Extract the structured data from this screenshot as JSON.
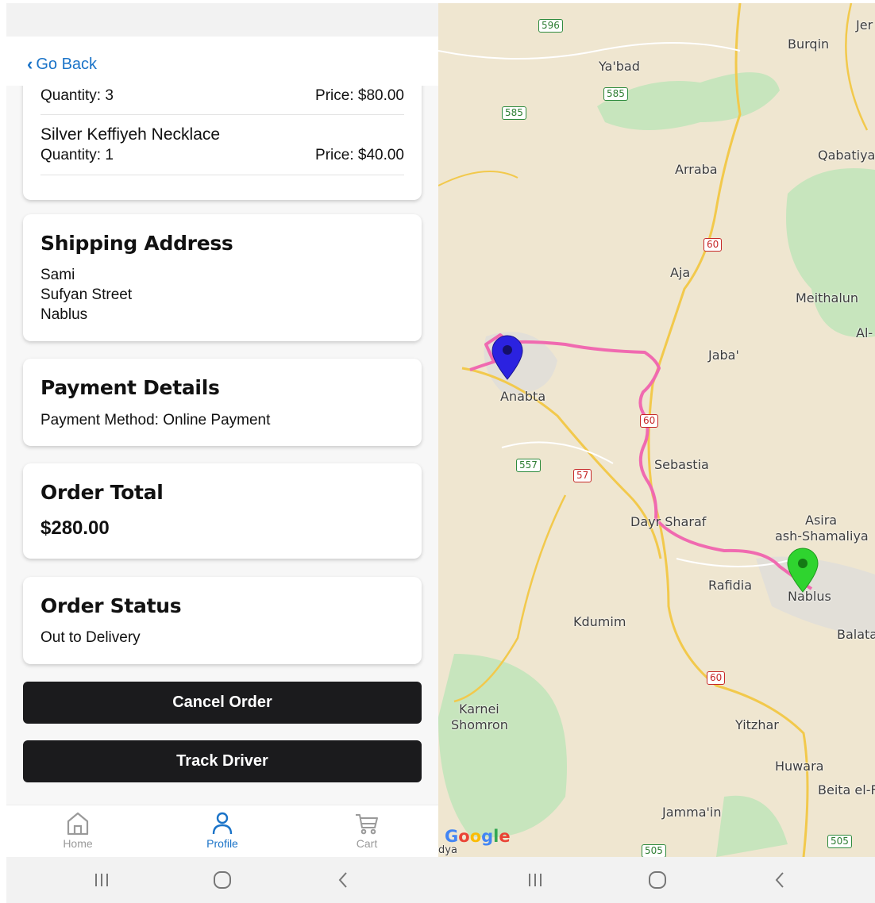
{
  "nav": {
    "back_label": "Go Back"
  },
  "order_items": [
    {
      "name": "",
      "quantity": "Quantity: 3",
      "price": "Price: $80.00"
    },
    {
      "name": "Silver Keffiyeh Necklace",
      "quantity": "Quantity: 1",
      "price": "Price: $40.00"
    }
  ],
  "shipping": {
    "title": "Shipping Address",
    "name": "Sami",
    "street": "Sufyan Street",
    "city": "Nablus"
  },
  "payment": {
    "title": "Payment Details",
    "method": "Payment Method: Online Payment"
  },
  "total": {
    "title": "Order Total",
    "amount": "$280.00"
  },
  "status": {
    "title": "Order Status",
    "value": "Out to Delivery"
  },
  "buttons": {
    "cancel": "Cancel Order",
    "track": "Track Driver"
  },
  "tabs": [
    {
      "label": "Home",
      "icon": "home-icon"
    },
    {
      "label": "Profile",
      "icon": "profile-icon",
      "active": true
    },
    {
      "label": "Cart",
      "icon": "cart-icon"
    }
  ],
  "colors": {
    "accent": "#1a73c8",
    "button_bg": "#1b1b1d",
    "route": "#f06ab0",
    "driver_pin": "#2b22e0",
    "destination_pin": "#2fd42f"
  },
  "map": {
    "places": [
      "Ya'bad",
      "Burqin",
      "Jer",
      "Qabatiya",
      "Arraba",
      "Aja",
      "Meithalun",
      "Al-",
      "Jaba'",
      "Anabta",
      "Sebastia",
      "Dayr Sharaf",
      "Asira",
      "ash-Shamaliya",
      "Rafidia",
      "Nablus",
      "Balata",
      "Kdumim",
      "Karnei",
      "Shomron",
      "Yitzhar",
      "Huwara",
      "Beita el-F",
      "Jamma'in",
      "dya"
    ],
    "roads": [
      "596",
      "585",
      "585",
      "60",
      "60",
      "557",
      "57",
      "60",
      "505",
      "505"
    ],
    "attribution": "Google"
  }
}
